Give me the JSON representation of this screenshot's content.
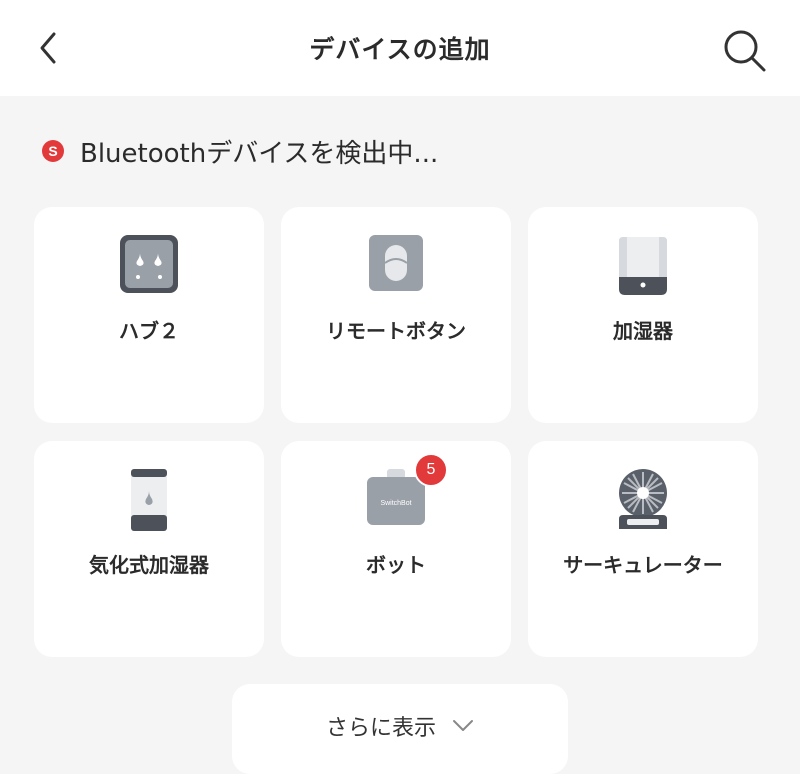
{
  "header": {
    "title": "デバイスの追加"
  },
  "scan": {
    "icon_letter": "S",
    "text": "Bluetoothデバイスを検出中..."
  },
  "devices": [
    {
      "label": "ハブ２",
      "icon": "hub2-icon"
    },
    {
      "label": "リモートボタン",
      "icon": "remote-button-icon"
    },
    {
      "label": "加湿器",
      "icon": "humidifier-icon"
    },
    {
      "label": "気化式加湿器",
      "icon": "evaporative-humidifier-icon"
    },
    {
      "label": "ボット",
      "icon": "bot-icon",
      "badge": "5",
      "bot_text": "SwitchBot"
    },
    {
      "label": "サーキュレーター",
      "icon": "circulator-icon"
    }
  ],
  "more": {
    "label": "さらに表示"
  },
  "colors": {
    "accent": "#e2393b",
    "background": "#f5f5f5",
    "card": "#ffffff",
    "device_gray": "#9aa0a8"
  }
}
